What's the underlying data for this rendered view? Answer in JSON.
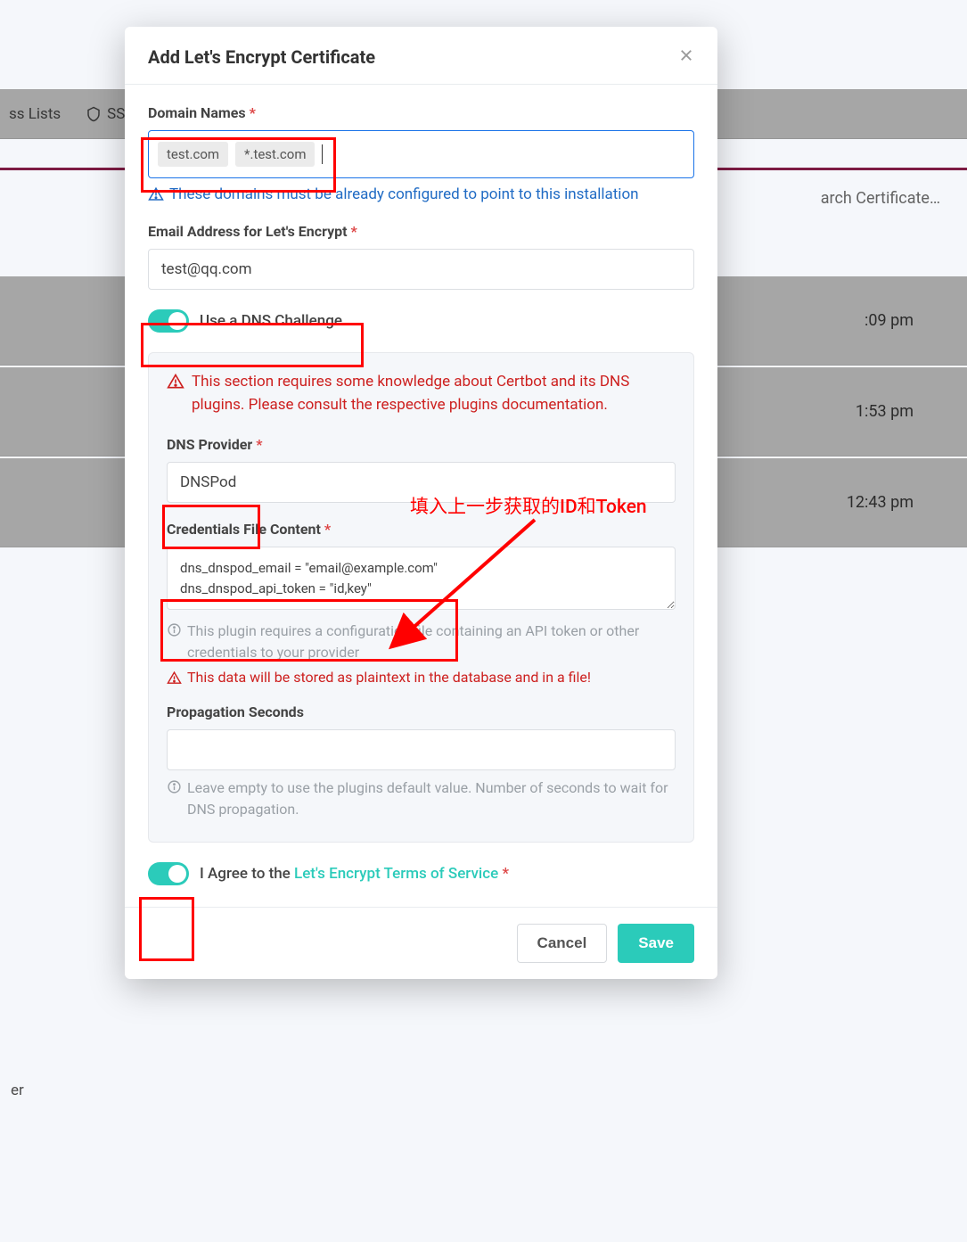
{
  "bg": {
    "tab_lists": "ss Lists",
    "tab_ssl": "SSl",
    "search_placeholder": "arch Certificate…",
    "rows": [
      ":09 pm",
      "1:53 pm",
      "12:43 pm"
    ],
    "footer": "er"
  },
  "modal": {
    "title": "Add Let's Encrypt Certificate",
    "domain_label": "Domain Names",
    "domain_tags": [
      "test.com",
      "*.test.com"
    ],
    "domain_hint": "These domains must be already configured to point to this installation",
    "email_label": "Email Address for Let's Encrypt",
    "email_value": "test@qq.com",
    "dns_toggle_label": "Use a DNS Challenge",
    "dns_warning": "This section requires some knowledge about Certbot and its DNS plugins. Please consult the respective plugins documentation.",
    "dns_provider_label": "DNS Provider",
    "dns_provider_value": "DNSPod",
    "creds_label": "Credentials File Content",
    "creds_value": "dns_dnspod_email = \"email@example.com\"\ndns_dnspod_api_token = \"id,key\"",
    "creds_info": "This plugin requires a configuration file containing an API token or other credentials to your provider",
    "creds_warn": "This data will be stored as plaintext in the database and in a file!",
    "prop_label": "Propagation Seconds",
    "prop_value": "",
    "prop_info": "Leave empty to use the plugins default value. Number of seconds to wait for DNS propagation.",
    "agree_prefix": "I Agree to the ",
    "agree_link": "Let's Encrypt Terms of Service",
    "cancel": "Cancel",
    "save": "Save"
  },
  "annotation": {
    "text": "填入上一步获取的ID和Token"
  }
}
